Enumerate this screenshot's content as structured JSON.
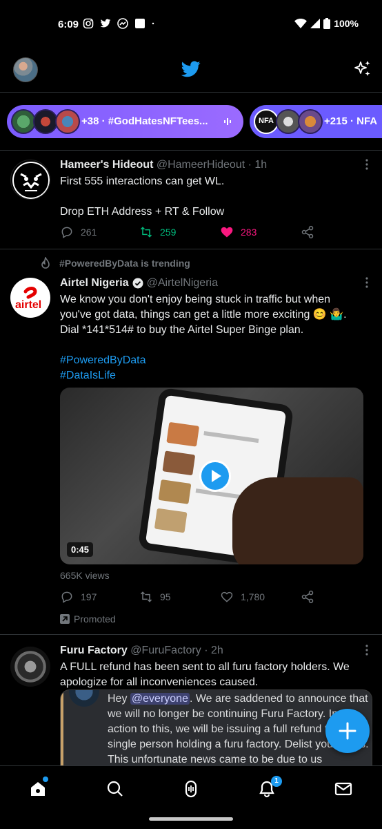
{
  "status_bar": {
    "time": "6:09",
    "battery": "100%",
    "icons": [
      "instagram-icon",
      "twitter-icon",
      "messenger-icon",
      "square-icon",
      "dot-icon",
      "wifi-icon",
      "signal-icon",
      "battery-icon"
    ]
  },
  "header": {
    "logo": "twitter-bird-icon",
    "right_icon": "sparkle-icon",
    "accent_color": "#1d9bf0"
  },
  "spaces": [
    {
      "count": "+38",
      "title": "#GodHatesNFTees...",
      "full_label": "+38 · #GodHatesNFTees..."
    },
    {
      "count": "+215",
      "title": "NFA",
      "full_label": "+215 · NFA"
    }
  ],
  "tweets": [
    {
      "name": "Hameer's Hideout",
      "handle": "@HameerHideout",
      "time": "· 1h",
      "lines": [
        "First 555 interactions can get WL.",
        "",
        "Drop ETH Address + RT & Follow"
      ],
      "replies": "261",
      "retweets": "259",
      "likes": "283"
    },
    {
      "trend": "#PoweredByData is trending",
      "name": "Airtel Nigeria",
      "handle": "@AirtelNigeria",
      "avatar_text": "airtel",
      "text": "We know you don't enjoy being stuck in traffic but when you've got data, things can get a little more exciting 😊 🤷‍♂️. Dial *141*514# to buy the Airtel Super Binge plan.",
      "hashtags": [
        "#PoweredByData",
        "#DataIsLife"
      ],
      "video_duration": "0:45",
      "views": "665K views",
      "replies": "197",
      "retweets": "95",
      "likes": "1,780",
      "promoted": "Promoted"
    },
    {
      "name": "Furu Factory",
      "handle": "@FuruFactory",
      "time": "· 2h",
      "text": "A FULL refund has been sent to all furu factory holders. We apologize for all inconveniences caused.",
      "quote_prefix": "Hey ",
      "quote_mention": "@everyone",
      "quote_text": ". We are saddened to announce that we will no longer be continuing Furu Factory. In action to this, we will be issuing a full refund to every single person holding a furu factory. Delist your NFTs. This unfortunate news came to be due to us"
    }
  ],
  "nav": {
    "items": [
      "home-icon",
      "search-icon",
      "spaces-icon",
      "notifications-icon",
      "messages-icon"
    ],
    "notifications_badge": "1"
  }
}
